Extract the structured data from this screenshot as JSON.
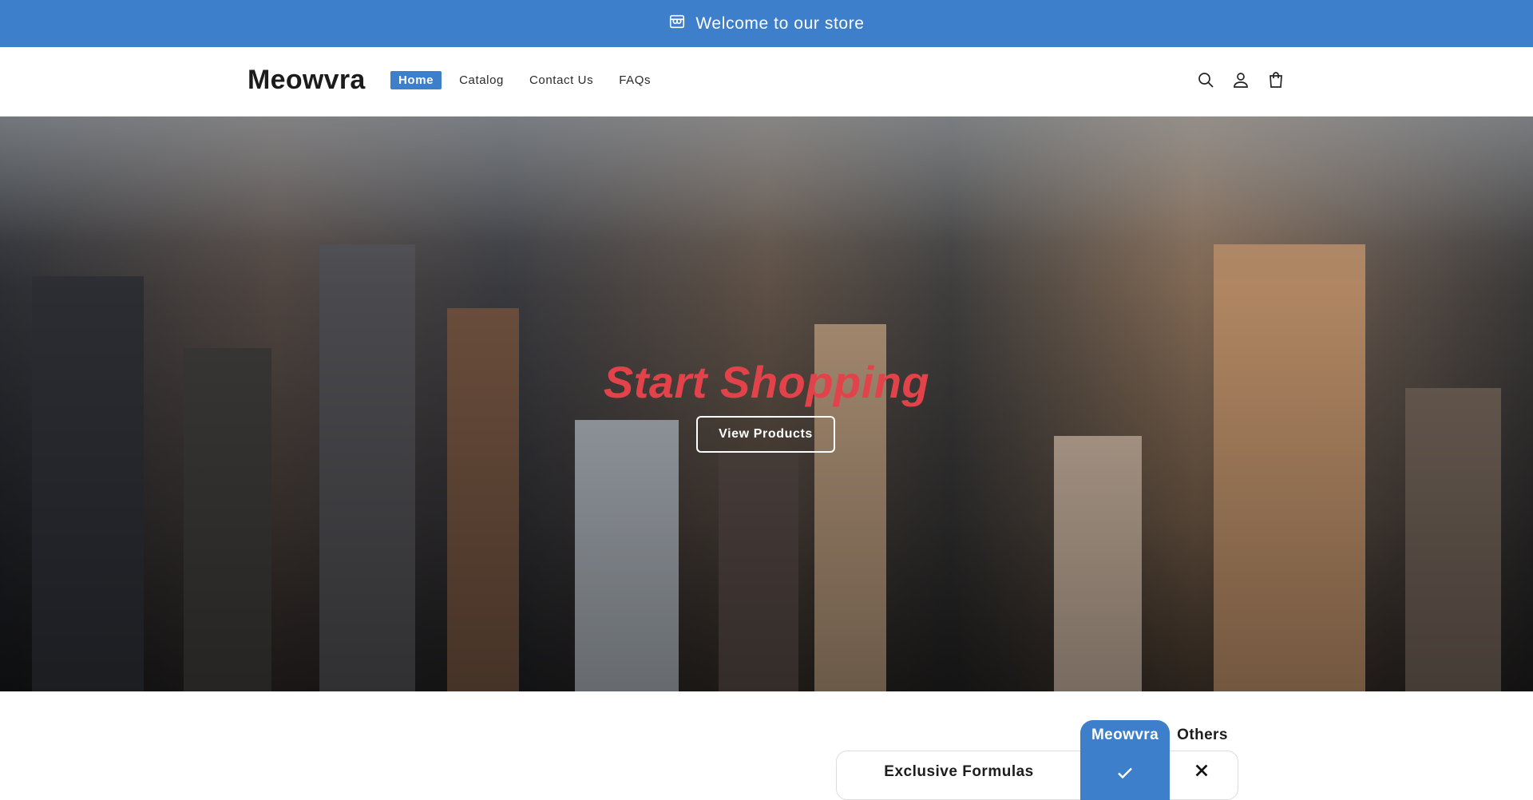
{
  "announcement": {
    "text": "Welcome to our store",
    "icon": "store-icon",
    "background": "#3d7fcb"
  },
  "header": {
    "logo": "Meowvra",
    "nav": [
      {
        "label": "Home",
        "active": true
      },
      {
        "label": "Catalog",
        "active": false
      },
      {
        "label": "Contact Us",
        "active": false
      },
      {
        "label": "FAQs",
        "active": false
      }
    ],
    "icons": [
      "search-icon",
      "account-icon",
      "cart-icon"
    ]
  },
  "hero": {
    "title": "Start Shopping",
    "title_color": "#e2434a",
    "button_label": "View Products",
    "background_image": "aerial city skyline"
  },
  "comparison": {
    "brand_column": "Meowvra",
    "other_column": "Others",
    "rows": [
      {
        "feature": "Exclusive Formulas",
        "brand": "check",
        "others": "cross"
      }
    ],
    "accent": "#3d7fcb"
  }
}
